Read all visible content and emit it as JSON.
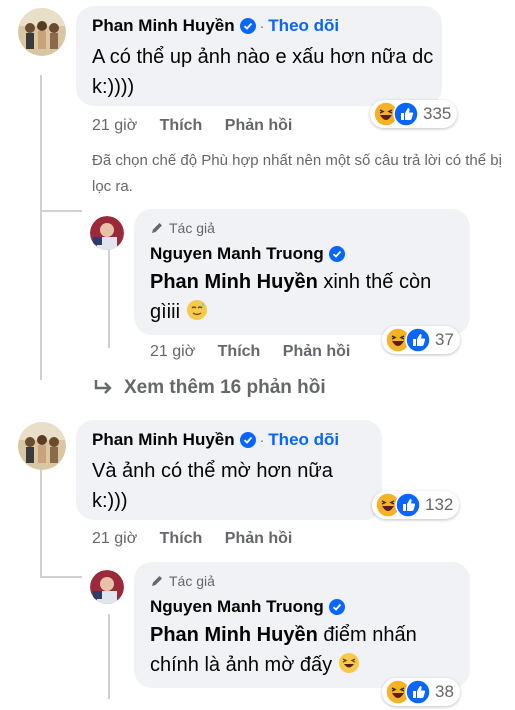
{
  "comment1": {
    "author": "Phan Minh Huyền",
    "follow": "Theo dõi",
    "text": "A có thể up ảnh nào e xấu hơn nữa dc k:))))",
    "reaction_count": "335",
    "time": "21 giờ",
    "like": "Thích",
    "reply": "Phản hồi"
  },
  "filter_notice": "Đã chọn chế độ Phù hợp nhất nên một số câu trả lời có thể bị lọc ra.",
  "reply1": {
    "badge": "Tác giả",
    "author": "Nguyen Manh Truong",
    "mention": "Phan Minh Huyền",
    "text": "xinh thế còn gìiii",
    "reaction_count": "37",
    "time": "21 giờ",
    "like": "Thích",
    "reply": "Phản hồi"
  },
  "see_more": "Xem thêm 16 phản hồi",
  "comment2": {
    "author": "Phan Minh Huyền",
    "follow": "Theo dõi",
    "text": "Và ảnh có thể mờ hơn nữa k:)))",
    "reaction_count": "132",
    "time": "21 giờ",
    "like": "Thích",
    "reply": "Phản hồi"
  },
  "reply2": {
    "badge": "Tác giả",
    "author": "Nguyen Manh Truong",
    "mention": "Phan Minh Huyền",
    "text": "điểm nhấn chính là ảnh mờ đấy",
    "reaction_count": "38"
  },
  "icons": [
    "verified-badge-icon",
    "pencil-icon",
    "reply-arrow-icon",
    "haha-reaction-icon",
    "like-reaction-icon",
    "sweat-smile-emoji-icon",
    "laugh-emoji-icon"
  ],
  "colors": {
    "link": "#0866ff",
    "muted": "#65676b",
    "bubble": "#f0f2f5",
    "verified": "#0866ff",
    "haha": "#f7b125"
  }
}
